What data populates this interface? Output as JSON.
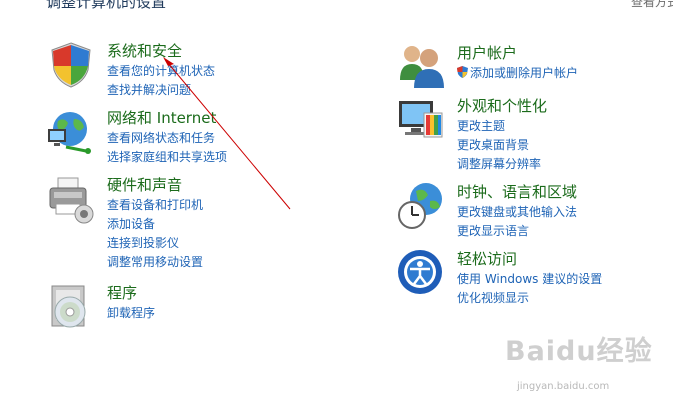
{
  "header": {
    "title": "调整计算机的设置",
    "view_by": "查看方式"
  },
  "left_categories": [
    {
      "title": "系统和安全",
      "icon": "security-shield-icon",
      "links": [
        "查看您的计算机状态",
        "查找并解决问题"
      ]
    },
    {
      "title": "网络和 Internet",
      "icon": "network-globe-icon",
      "links": [
        "查看网络状态和任务",
        "选择家庭组和共享选项"
      ]
    },
    {
      "title": "硬件和声音",
      "icon": "printer-icon",
      "links": [
        "查看设备和打印机",
        "添加设备",
        "连接到投影仪",
        "调整常用移动设置"
      ]
    },
    {
      "title": "程序",
      "icon": "programs-disc-icon",
      "links": [
        "卸载程序"
      ]
    }
  ],
  "right_categories": [
    {
      "title": "用户帐户",
      "icon": "users-icon",
      "links": [
        "添加或删除用户帐户"
      ]
    },
    {
      "title": "外观和个性化",
      "icon": "monitor-palette-icon",
      "links": [
        "更改主题",
        "更改桌面背景",
        "调整屏幕分辨率"
      ]
    },
    {
      "title": "时钟、语言和区域",
      "icon": "clock-globe-icon",
      "links": [
        "更改键盘或其他输入法",
        "更改显示语言"
      ]
    },
    {
      "title": "轻松访问",
      "icon": "ease-of-access-icon",
      "links": [
        "使用 Windows 建议的设置",
        "优化视频显示"
      ]
    }
  ],
  "watermark": {
    "logo": "Baidu经验",
    "url": "jingyan.baidu.com"
  },
  "colors": {
    "category_title": "#1b6b1b",
    "link": "#1f64b6",
    "annotation_arrow": "#cc0000"
  }
}
